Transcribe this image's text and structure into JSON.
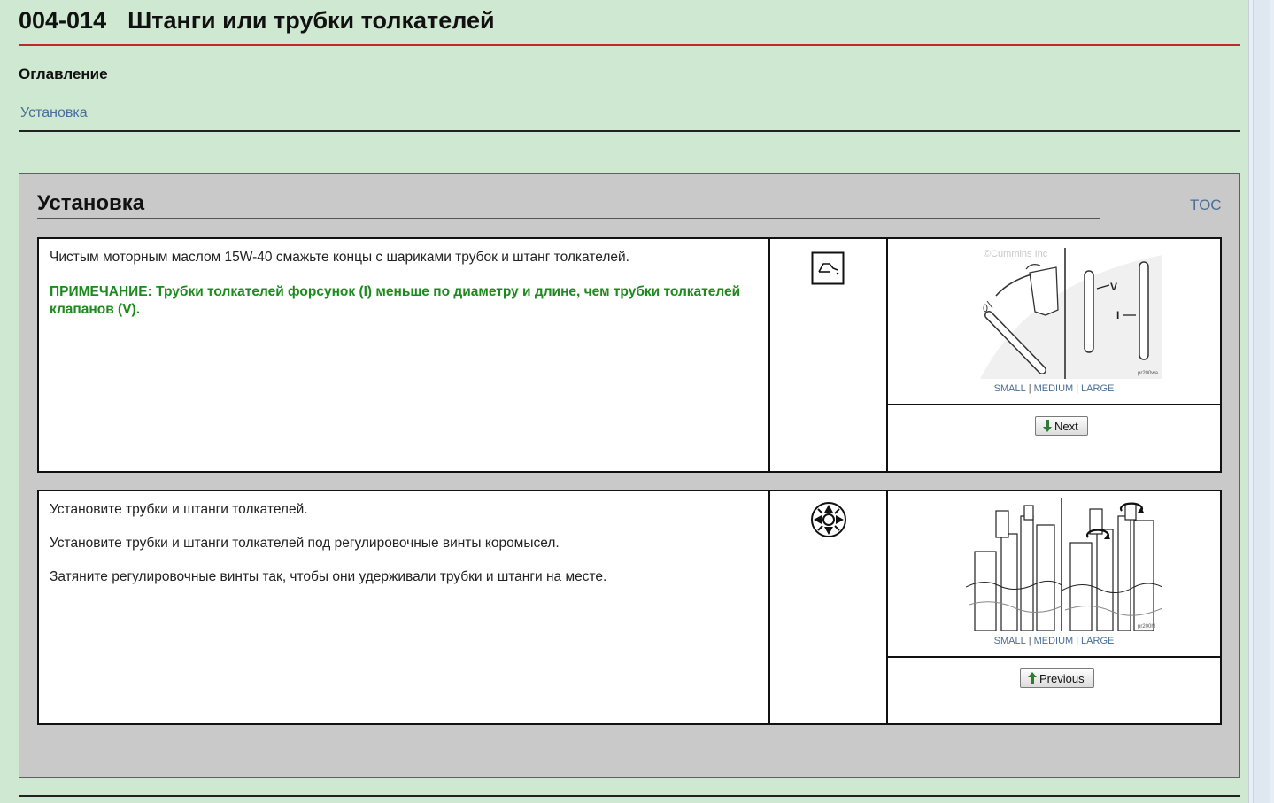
{
  "header": {
    "doc_number": "004-014",
    "title": "Штанги или трубки толкателей"
  },
  "toc": {
    "heading": "Оглавление",
    "link": "Установка"
  },
  "section": {
    "title": "Установка",
    "toc_link": "TOC"
  },
  "steps": [
    {
      "paragraphs": [
        "Чистым моторным маслом 15W-40 смажьте концы с шариками трубок и штанг толкателей."
      ],
      "note_label": "ПРИМЕЧАНИЕ",
      "note_text": ": Трубки толкателей форсунок (I) меньше по диаметру и длине, чем трубки толкателей клапанов (V).",
      "icon": "oil-can-icon",
      "image_watermark": "©Cummins Inc",
      "image_code": "pr200wa",
      "label_v": "V",
      "label_i": "I",
      "sizes": [
        "SMALL",
        "MEDIUM",
        "LARGE"
      ],
      "nav_button": "Next"
    },
    {
      "paragraphs": [
        "Установите трубки и штанги толкателей.",
        "Установите трубки и штанги толкателей под регулировочные винты коромысел.",
        "Затяните регулировочные винты так, чтобы они удерживали трубки и штанги на месте."
      ],
      "icon": "wrench-socket-icon",
      "image_code": "pr200hl",
      "sizes": [
        "SMALL",
        "MEDIUM",
        "LARGE"
      ],
      "nav_button": "Previous"
    }
  ],
  "colors": {
    "background": "#cfe8d1",
    "title_rule": "#c0282d",
    "link": "#4a6f97",
    "note": "#1c8a1c",
    "section_bg": "#c9c9c9"
  }
}
